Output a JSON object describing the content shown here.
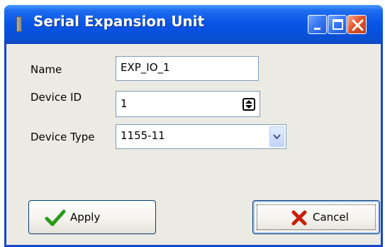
{
  "window": {
    "title": "Serial Expansion Unit",
    "controls": [
      "minimize-icon",
      "maximize-icon",
      "close-icon"
    ]
  },
  "form": {
    "name_label": "Name",
    "name_value": "EXP_IO_1",
    "device_id_label": "Device ID",
    "device_id_value": "1",
    "device_type_label": "Device Type",
    "device_type_value": "1155-11"
  },
  "buttons": {
    "apply_label": "Apply",
    "cancel_label": "Cancel"
  },
  "colors": {
    "titlebar": "#0a55e6",
    "window_bg": "#ecebe3",
    "apply_check": "#2a9a1a",
    "cancel_x": "#c81e0a"
  }
}
